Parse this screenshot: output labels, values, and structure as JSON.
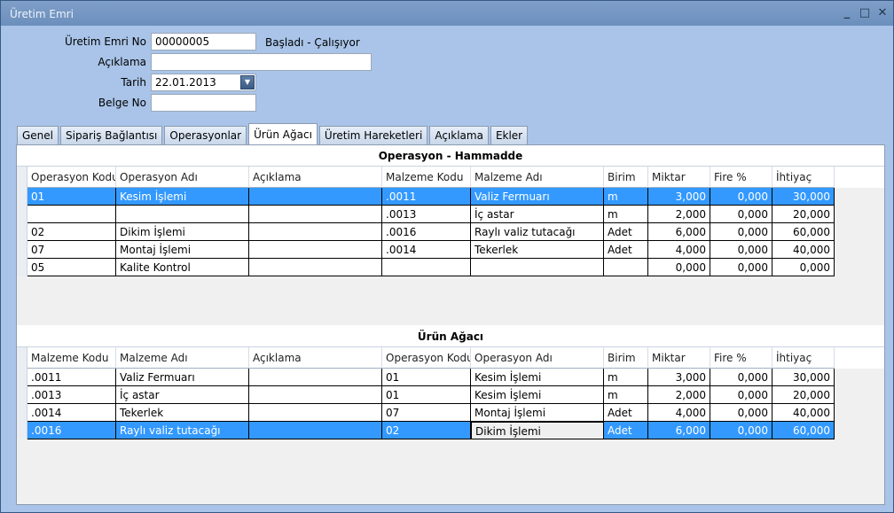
{
  "window": {
    "title": "Üretim Emri",
    "ctrl_min": "_",
    "ctrl_max": "□",
    "ctrl_close": "✕"
  },
  "form": {
    "emri_no_label": "Üretim Emri No",
    "emri_no_value": "00000005",
    "status": "Başladı - Çalışıyor",
    "aciklama_label": "Açıklama",
    "aciklama_value": "",
    "tarih_label": "Tarih",
    "tarih_value": "22.01.2013",
    "belge_label": "Belge No",
    "belge_value": ""
  },
  "tabs": [
    "Genel",
    "Sipariş Bağlantısı",
    "Operasyonlar",
    "Ürün Ağacı",
    "Üretim Hareketleri",
    "Açıklama",
    "Ekler"
  ],
  "active_tab": "Ürün Ağacı",
  "grid1": {
    "caption": "Operasyon - Hammadde",
    "columns": [
      "Operasyon Kodu",
      "Operasyon Adı",
      "Açıklama",
      "Malzeme Kodu",
      "Malzeme Adı",
      "Birim",
      "Miktar",
      "Fire %",
      "İhtiyaç"
    ],
    "rows": [
      [
        "01",
        "Kesim İşlemi",
        "",
        ".0011",
        "Valiz Fermuarı",
        "m",
        "3,000",
        "0,000",
        "30,000"
      ],
      [
        "",
        "",
        "",
        ".0013",
        "İç astar",
        "m",
        "2,000",
        "0,000",
        "20,000"
      ],
      [
        "02",
        "Dikim İşlemi",
        "",
        ".0016",
        "Raylı valiz tutacağı",
        "Adet",
        "6,000",
        "0,000",
        "60,000"
      ],
      [
        "07",
        "Montaj İşlemi",
        "",
        ".0014",
        "Tekerlek",
        "Adet",
        "4,000",
        "0,000",
        "40,000"
      ],
      [
        "05",
        "Kalite Kontrol",
        "",
        "",
        "",
        "",
        "0,000",
        "0,000",
        "0,000"
      ]
    ],
    "selected_row": 0
  },
  "grid2": {
    "caption": "Ürün Ağacı",
    "columns": [
      "Malzeme Kodu",
      "Malzeme Adı",
      "Açıklama",
      "Operasyon Kodu",
      "Operasyon Adı",
      "Birim",
      "Miktar",
      "Fire %",
      "İhtiyaç"
    ],
    "rows": [
      [
        ".0011",
        "Valiz Fermuarı",
        "",
        "01",
        "Kesim İşlemi",
        "m",
        "3,000",
        "0,000",
        "30,000"
      ],
      [
        ".0013",
        "İç astar",
        "",
        "01",
        "Kesim İşlemi",
        "m",
        "2,000",
        "0,000",
        "20,000"
      ],
      [
        ".0014",
        "Tekerlek",
        "",
        "07",
        "Montaj İşlemi",
        "Adet",
        "4,000",
        "0,000",
        "40,000"
      ],
      [
        ".0016",
        "Raylı valiz tutacağı",
        "",
        "02",
        "Dikim İşlemi",
        "Adet",
        "6,000",
        "0,000",
        "60,000"
      ]
    ],
    "selected_row": 3
  }
}
